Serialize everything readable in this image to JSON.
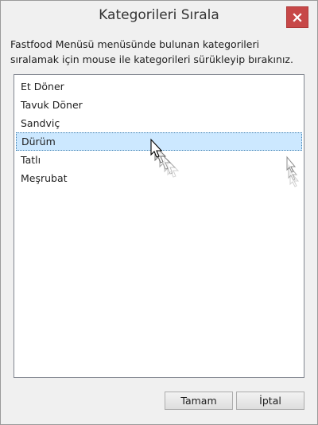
{
  "window": {
    "title": "Kategorileri Sırala"
  },
  "instruction": "Fastfood Menüsü menüsünde bulunan kategorileri\nsıralamak için mouse ile kategorileri sürükleyip bırakınız.",
  "list": {
    "items": [
      {
        "label": "Et Döner",
        "selected": false
      },
      {
        "label": "Tavuk Döner",
        "selected": false
      },
      {
        "label": "Sandviç",
        "selected": false
      },
      {
        "label": "Dürüm",
        "selected": true
      },
      {
        "label": "Tatlı",
        "selected": false
      },
      {
        "label": "Meşrubat",
        "selected": false
      }
    ]
  },
  "buttons": {
    "ok_label": "Tamam",
    "cancel_label": "İptal"
  },
  "colors": {
    "close_button": "#c74848",
    "selection": "#cce8ff"
  },
  "icons": {
    "close": "close-icon",
    "cursor": "drag-cursor-icon"
  }
}
